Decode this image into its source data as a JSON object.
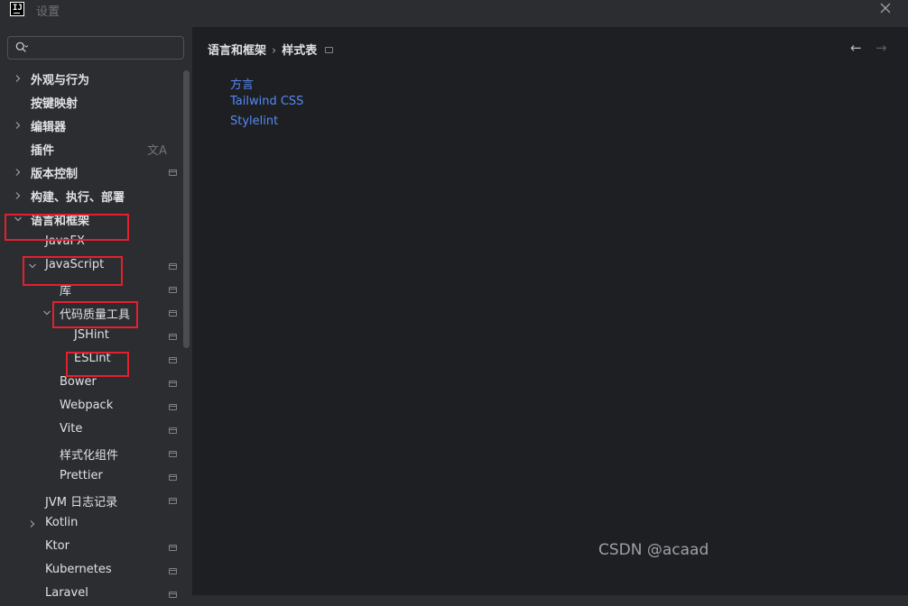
{
  "window": {
    "title": "设置",
    "logo_text": "IJ"
  },
  "search": {
    "value": "",
    "placeholder": ""
  },
  "tree": [
    {
      "label": "外观与行为",
      "bold": true,
      "chevron": "right",
      "icon": false
    },
    {
      "label": "按键映射",
      "bold": true,
      "chevron": "",
      "icon": false
    },
    {
      "label": "编辑器",
      "bold": true,
      "chevron": "right",
      "icon": false
    },
    {
      "label": "插件",
      "bold": true,
      "chevron": "",
      "icon": false,
      "translate_icon": "文A"
    },
    {
      "label": "版本控制",
      "bold": true,
      "chevron": "right",
      "icon": true
    },
    {
      "label": "构建、执行、部署",
      "bold": true,
      "chevron": "right",
      "icon": false
    },
    {
      "label": "语言和框架",
      "bold": true,
      "chevron": "down",
      "icon": false
    },
    {
      "label": "JavaFX",
      "bold": false,
      "chevron": "",
      "icon": false
    },
    {
      "label": "JavaScript",
      "bold": false,
      "chevron": "down",
      "icon": true
    },
    {
      "label": "库",
      "bold": false,
      "chevron": "",
      "icon": true
    },
    {
      "label": "代码质量工具",
      "bold": false,
      "chevron": "down",
      "icon": true
    },
    {
      "label": "JSHint",
      "bold": false,
      "chevron": "",
      "icon": true
    },
    {
      "label": "ESLint",
      "bold": false,
      "chevron": "",
      "icon": true
    },
    {
      "label": "Bower",
      "bold": false,
      "chevron": "",
      "icon": true
    },
    {
      "label": "Webpack",
      "bold": false,
      "chevron": "",
      "icon": true
    },
    {
      "label": "Vite",
      "bold": false,
      "chevron": "",
      "icon": true
    },
    {
      "label": "样式化组件",
      "bold": false,
      "chevron": "",
      "icon": true
    },
    {
      "label": "Prettier",
      "bold": false,
      "chevron": "",
      "icon": true
    },
    {
      "label": "JVM 日志记录",
      "bold": false,
      "chevron": "",
      "icon": true
    },
    {
      "label": "Kotlin",
      "bold": false,
      "chevron": "right",
      "icon": false
    },
    {
      "label": "Ktor",
      "bold": false,
      "chevron": "",
      "icon": true
    },
    {
      "label": "Kubernetes",
      "bold": false,
      "chevron": "",
      "icon": true
    },
    {
      "label": "Laravel",
      "bold": false,
      "chevron": "",
      "icon": true
    }
  ],
  "breadcrumb": {
    "parent": "语言和框架",
    "separator": "›",
    "current": "样式表"
  },
  "nav": {
    "back": "←",
    "forward": "→"
  },
  "links": [
    "方言",
    "Tailwind CSS",
    "Stylelint"
  ],
  "watermark": "CSDN @acaad",
  "colors": {
    "link": "#548af7",
    "highlight_box": "#e5202e",
    "sidebar_bg": "#2b2d30",
    "content_bg": "#1e1f22"
  }
}
